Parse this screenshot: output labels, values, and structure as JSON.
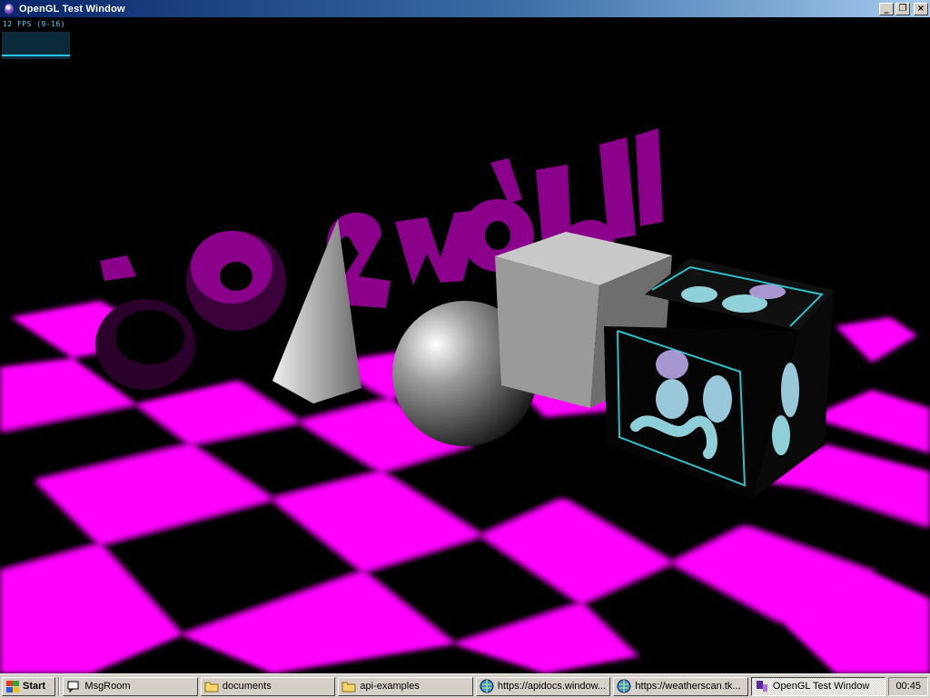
{
  "window": {
    "title": "OpenGL Test Window",
    "controls": {
      "minimize": "_",
      "restore": "❐",
      "close": "×"
    }
  },
  "overlay": {
    "fps_text": "12 FPS (9-16)"
  },
  "scene": {
    "text_3d": "3d-zwobj",
    "colors": {
      "floor": "#ff00ff",
      "background": "#000000",
      "text": "#8a008a",
      "cube": "#9a9a9a",
      "texture_glow": "#7fe8ee"
    }
  },
  "taskbar": {
    "start_label": "Start",
    "items": [
      {
        "label": "MsgRoom",
        "icon": "chat-icon"
      },
      {
        "label": "documents",
        "icon": "folder-icon"
      },
      {
        "label": "api-examples",
        "icon": "folder-icon"
      },
      {
        "label": "https://apidocs.window...",
        "icon": "browser-icon"
      },
      {
        "label": "https://weatherscan.tk...",
        "icon": "browser-icon"
      },
      {
        "label": "OpenGL Test Window",
        "icon": "opengl-app-icon",
        "active": true
      }
    ],
    "clock": "00:45"
  }
}
